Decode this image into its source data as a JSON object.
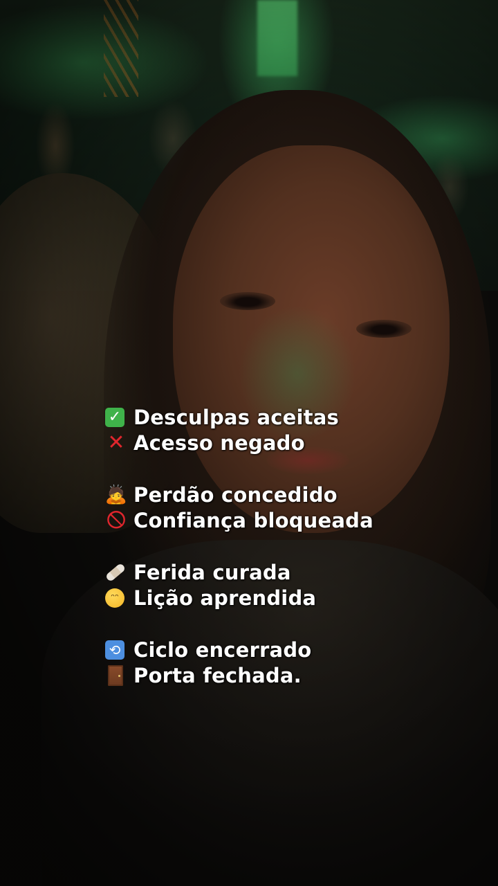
{
  "overlay": {
    "lines": [
      {
        "icon": "check-mark-button-icon",
        "glyph": "✓",
        "text": "Desculpas aceitas"
      },
      {
        "icon": "cross-mark-icon",
        "glyph": "✕",
        "text": "Acesso negado"
      },
      {
        "icon": "person-bowing-icon",
        "glyph": "🙇",
        "text": "Perdão concedido"
      },
      {
        "icon": "prohibited-icon",
        "glyph": "🛇",
        "text": "Confiança bloqueada"
      },
      {
        "icon": "adhesive-bandage-icon",
        "glyph": "",
        "text": "Ferida curada"
      },
      {
        "icon": "pleading-face-icon",
        "glyph": "ᵔᵔ",
        "text": "Lição aprendida"
      },
      {
        "icon": "repeat-button-icon",
        "glyph": "⟲",
        "text": "Ciclo encerrado"
      },
      {
        "icon": "door-icon",
        "glyph": "",
        "text": "Porta fechada."
      }
    ]
  },
  "colors": {
    "text": "#ffffff",
    "check_green": "#3fb24a",
    "cross_red": "#e0262d",
    "repeat_blue": "#4d8fe0"
  }
}
